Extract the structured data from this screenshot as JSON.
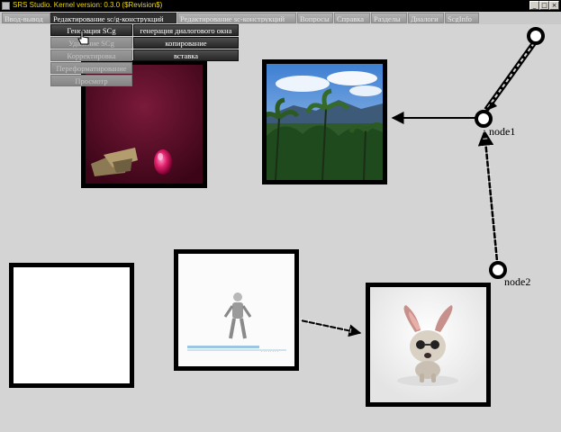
{
  "window": {
    "title": "SRS Studio. Kernel version: 0.3.0 ($Revision$)",
    "controls": [
      "_",
      "□",
      "×"
    ]
  },
  "menu": {
    "items": [
      "Ввод-вывод",
      "Редактирование sc/g-конструкций",
      "Редактирование sc-конструкций",
      "Вопросы",
      "Справка",
      "Разделы",
      "Диалоги",
      "ScgInfo"
    ],
    "active_index": 1
  },
  "dropdown": {
    "main": [
      {
        "label": "Генерация SCg",
        "enabled": true
      },
      {
        "label": "Удаление SCg",
        "enabled": false
      },
      {
        "label": "Корректировка",
        "enabled": false
      },
      {
        "label": "Переформатирование",
        "enabled": false
      },
      {
        "label": "Просмотр",
        "enabled": false
      }
    ],
    "submenu": [
      "генерация диалогового окна",
      "копирование",
      "вставка"
    ]
  },
  "nodes": {
    "node1": "node1",
    "node2": "node2"
  },
  "colors": {
    "window_bg": "#d4d4d4",
    "title_text": "#f0d800",
    "frame_border": "#000000",
    "dark_red_bg": "#5a0a25"
  }
}
